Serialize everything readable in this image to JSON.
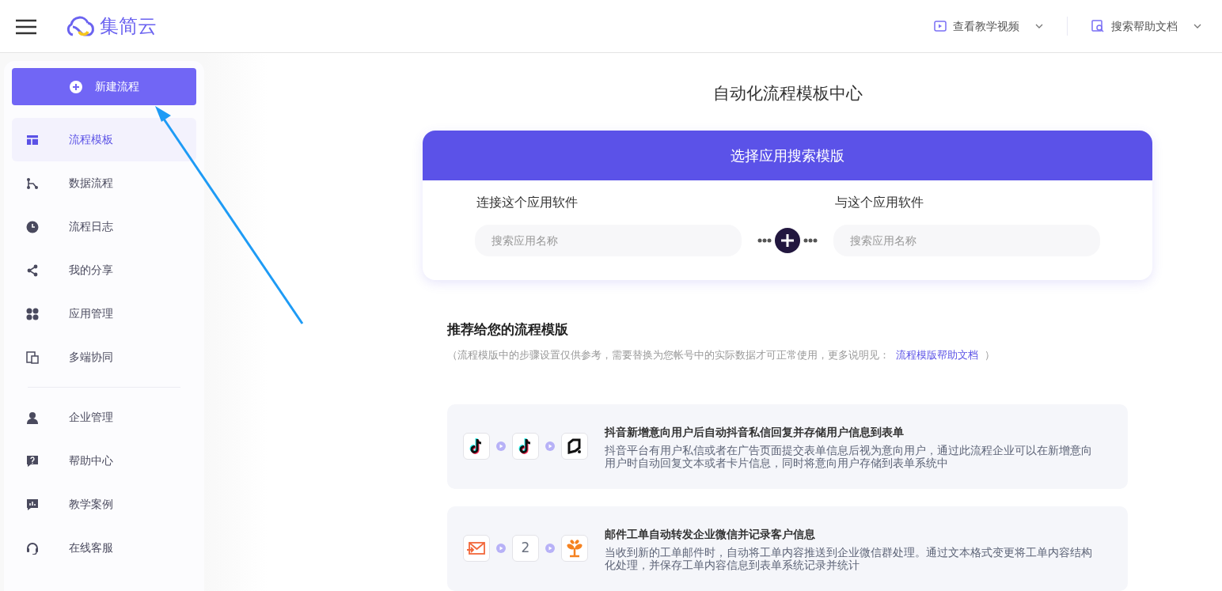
{
  "header": {
    "logo_text": "集简云",
    "links": [
      {
        "label": "查看教学视频",
        "kind": "video"
      },
      {
        "label": "搜索帮助文档",
        "kind": "doc"
      }
    ]
  },
  "sidebar": {
    "new_button": "新建流程",
    "groups": [
      [
        {
          "label": "流程模板",
          "kind": "template",
          "selected": true
        },
        {
          "label": "数据流程",
          "kind": "flow",
          "selected": false
        },
        {
          "label": "流程日志",
          "kind": "clock",
          "selected": false
        },
        {
          "label": "我的分享",
          "kind": "share",
          "selected": false
        },
        {
          "label": "应用管理",
          "kind": "apps",
          "selected": false
        },
        {
          "label": "多端协同",
          "kind": "devices",
          "selected": false
        }
      ],
      [
        {
          "label": "企业管理",
          "kind": "user",
          "selected": false
        },
        {
          "label": "帮助中心",
          "kind": "help",
          "selected": false
        },
        {
          "label": "教学案例",
          "kind": "chart",
          "selected": false
        },
        {
          "label": "在线客服",
          "kind": "headset",
          "selected": false
        }
      ]
    ]
  },
  "page_title": "自动化流程模板中心",
  "search_card": {
    "title": "选择应用搜索模版",
    "left_label": "连接这个应用软件",
    "left_placeholder": "搜索应用名称",
    "right_label": "与这个应用软件",
    "right_placeholder": "搜索应用名称"
  },
  "recommend": {
    "title": "推荐给您的流程模版",
    "note_before": "（流程模版中的步骤设置仅供参考，需要替换为您帐号中的实际数据才可正常使用，更多说明见：",
    "note_link": "流程模版帮助文档",
    "note_after": "）",
    "templates": [
      {
        "title": "抖音新增意向用户后自动抖音私信回复并存储用户信息到表单",
        "description": "抖音平台有用户私信或者在广告页面提交表单信息后视为意向用户，通过此流程企业可以在新增意向用户时自动回复文本或者卡片信息，同时将意向用户存储到表单系统中",
        "steps": [
          {
            "kind": "tiktok"
          },
          {
            "kind": "tiktok"
          },
          {
            "kind": "form"
          }
        ]
      },
      {
        "title": "邮件工单自动转发企业微信并记录客户信息",
        "description": "当收到新的工单邮件时，自动将工单内容推送到企业微信群处理。通过文本格式变更将工单内容结构化处理，并保存工单内容信息到表单系统记录并统计",
        "steps": [
          {
            "kind": "email"
          },
          {
            "kind": "count",
            "text": "2"
          },
          {
            "kind": "plant"
          }
        ]
      }
    ]
  }
}
